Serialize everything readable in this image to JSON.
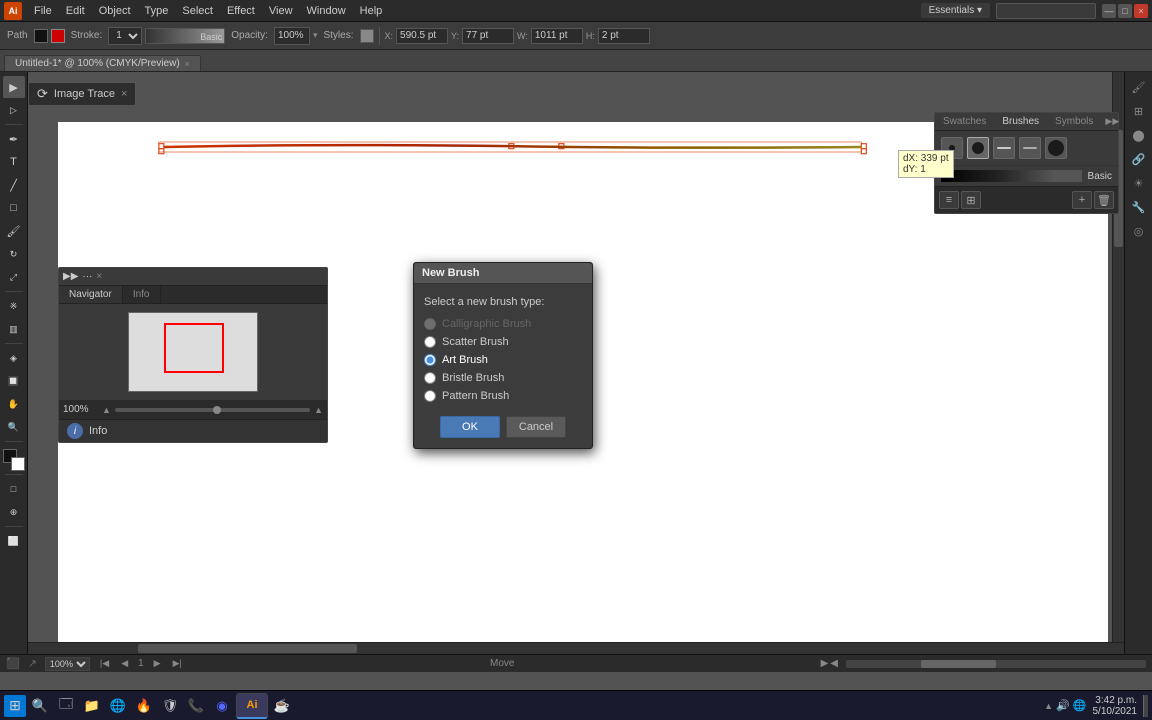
{
  "app": {
    "title": "Adobe Illustrator",
    "logo_text": "Ai",
    "tab_title": "Untitled-1* @ 100% (CMYK/Preview)",
    "tab_close": "×"
  },
  "menu": {
    "items": [
      "File",
      "Edit",
      "Object",
      "Type",
      "Select",
      "Effect",
      "View",
      "Window",
      "Help"
    ]
  },
  "toolbar": {
    "label_stroke": "Stroke:",
    "stroke_value": "",
    "label_basic": "Basic",
    "label_opacity": "Opacity:",
    "opacity_value": "100%",
    "label_styles": "Styles:",
    "label_x": "X:",
    "x_value": "590.5 pt",
    "label_y": "Y:",
    "y_value": "77 pt",
    "label_w": "W:",
    "w_value": "1011 pt",
    "label_h": "H:",
    "h_value": "2 pt"
  },
  "image_trace": {
    "label": "Image Trace"
  },
  "navigator_panel": {
    "title": "Navigator",
    "expand": "◀◀",
    "close": "×",
    "tab1": "Navigator",
    "tab2": "Info",
    "zoom_value": "100%"
  },
  "info_panel": {
    "label": "Info"
  },
  "brushes_panel": {
    "tab1": "Swatches",
    "tab2": "Brushes",
    "tab3": "Symbols",
    "expand": "▶▶",
    "close": "×",
    "stroke_label": "Basic",
    "brushes": [
      {
        "size": "small"
      },
      {
        "size": "medium"
      },
      {
        "size": "dash"
      },
      {
        "size": "dash2"
      },
      {
        "size": "large"
      }
    ]
  },
  "new_brush_dialog": {
    "title": "New Brush",
    "subtitle": "Select a new brush type:",
    "options": [
      {
        "id": "calligraphic",
        "label": "Calligraphic Brush",
        "disabled": true,
        "selected": false
      },
      {
        "id": "scatter",
        "label": "Scatter Brush",
        "disabled": false,
        "selected": false
      },
      {
        "id": "art",
        "label": "Art Brush",
        "disabled": false,
        "selected": true
      },
      {
        "id": "bristle",
        "label": "Bristle Brush",
        "disabled": false,
        "selected": false
      },
      {
        "id": "pattern",
        "label": "Pattern Brush",
        "disabled": false,
        "selected": false
      }
    ],
    "btn_ok": "OK",
    "btn_cancel": "Cancel"
  },
  "dx_tooltip": {
    "line1": "dX: 339 pt",
    "line2": "dY: 1"
  },
  "status_bar": {
    "zoom_value": "100%",
    "move_label": "Move",
    "nav_prev": "◀",
    "nav_next": "▶",
    "page_num": "1"
  },
  "taskbar": {
    "time": "3:42 p.m.",
    "date": "5/10/2021",
    "apps": [
      "⊞",
      "🔍",
      "🗔",
      "📁",
      "🌐",
      "🔥",
      "🛡",
      "📞",
      "🔵",
      "Ai",
      "☕"
    ]
  },
  "window_controls": {
    "minimize": "—",
    "maximize": "□",
    "close": "×"
  }
}
